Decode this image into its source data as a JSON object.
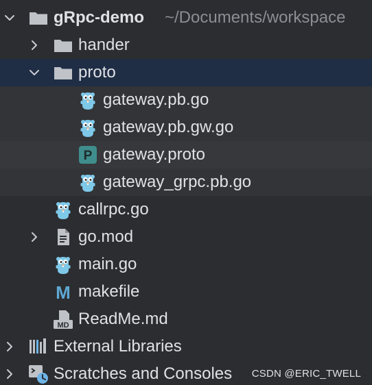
{
  "tree": {
    "root": {
      "name": "gRpc-demo",
      "path": "~/Documents/workspace"
    },
    "items": [
      {
        "label": "hander"
      },
      {
        "label": "proto"
      },
      {
        "label": "gateway.pb.go"
      },
      {
        "label": "gateway.pb.gw.go"
      },
      {
        "label": "gateway.proto",
        "badge": "P"
      },
      {
        "label": "gateway_grpc.pb.go"
      },
      {
        "label": "callrpc.go"
      },
      {
        "label": "go.mod"
      },
      {
        "label": "main.go"
      },
      {
        "label": "makefile",
        "badge": "M"
      },
      {
        "label": "ReadMe.md",
        "badge": "MD"
      },
      {
        "label": "External Libraries"
      },
      {
        "label": "Scratches and Consoles"
      }
    ]
  },
  "watermark": "CSDN @ERIC_TWELL",
  "colors": {
    "background": "#2b2d30",
    "selected_row": "#1f2e45",
    "text": "#dfe1e5",
    "muted_text": "#8b8e94",
    "gopher": "#7ec8e8",
    "proto_badge": "#3f8d8c",
    "folder": "#bfc2c7"
  }
}
